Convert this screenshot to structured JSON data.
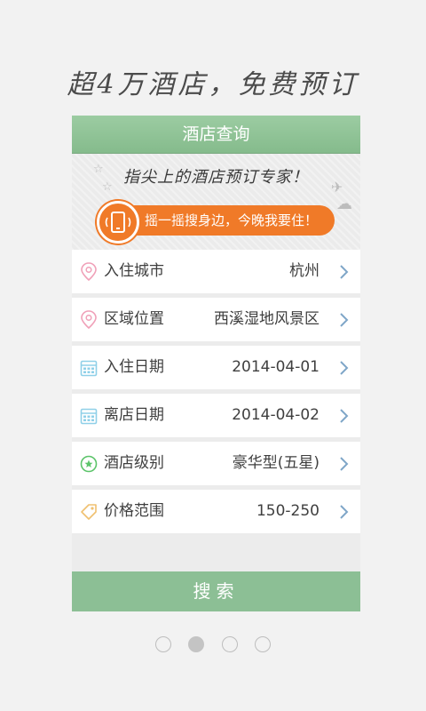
{
  "tagline": "超4万酒店，免费预订",
  "card": {
    "header_title": "酒店查询",
    "banner_slogan": "指尖上的酒店预订专家！",
    "shake_button_label": "摇一摇搜身边，今晚我要住！",
    "rows": [
      {
        "icon": "location-pin-icon",
        "label": "入住城市",
        "value": "杭州"
      },
      {
        "icon": "location-pin-icon",
        "label": "区域位置",
        "value": "西溪湿地风景区"
      },
      {
        "icon": "calendar-icon",
        "label": "入住日期",
        "value": "2014-04-01"
      },
      {
        "icon": "calendar-icon",
        "label": "离店日期",
        "value": "2014-04-02"
      },
      {
        "icon": "star-level-icon",
        "label": "酒店级别",
        "value": "豪华型(五星)"
      },
      {
        "icon": "price-tag-icon",
        "label": "价格范围",
        "value": "150-250"
      }
    ],
    "search_button_label": "搜索"
  },
  "pager": {
    "count": 4,
    "active_index": 1
  },
  "colors": {
    "header_green": "#8fc196",
    "search_green": "#8cbf95",
    "orange": "#f07a28",
    "pin_pink": "#f0a0b8",
    "calendar_blue": "#8fd0e8",
    "level_green": "#5cc46a",
    "tag_yellow": "#f0c070",
    "chevron_blue": "#7fa6c8"
  }
}
